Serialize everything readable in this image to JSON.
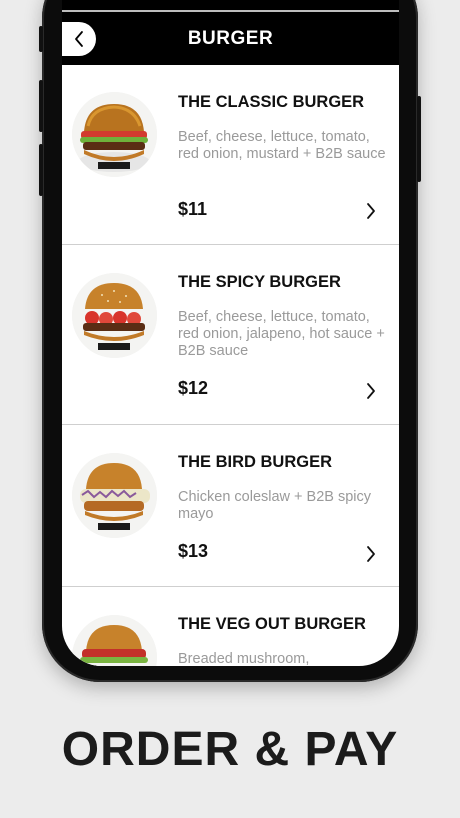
{
  "header": {
    "title": "BURGER"
  },
  "menu": {
    "items": [
      {
        "name": "THE CLASSIC BURGER",
        "description": "Beef, cheese, lettuce, tomato, red onion, mustard + B2B sauce",
        "price": "$11"
      },
      {
        "name": "THE SPICY BURGER",
        "description": "Beef, cheese, lettuce, tomato, red onion, jalapeno, hot sauce + B2B sauce",
        "price": "$12"
      },
      {
        "name": "THE BIRD BURGER",
        "description": "Chicken coleslaw + B2B spicy mayo",
        "price": "$13"
      },
      {
        "name": "THE VEG OUT BURGER",
        "description": "Breaded mushroom,",
        "price": ""
      }
    ]
  },
  "footer": {
    "tagline": "ORDER & PAY"
  },
  "colors": {
    "header_bg": "#000000",
    "background": "#ececec",
    "text": "#111111",
    "muted": "#9a9a9a"
  }
}
